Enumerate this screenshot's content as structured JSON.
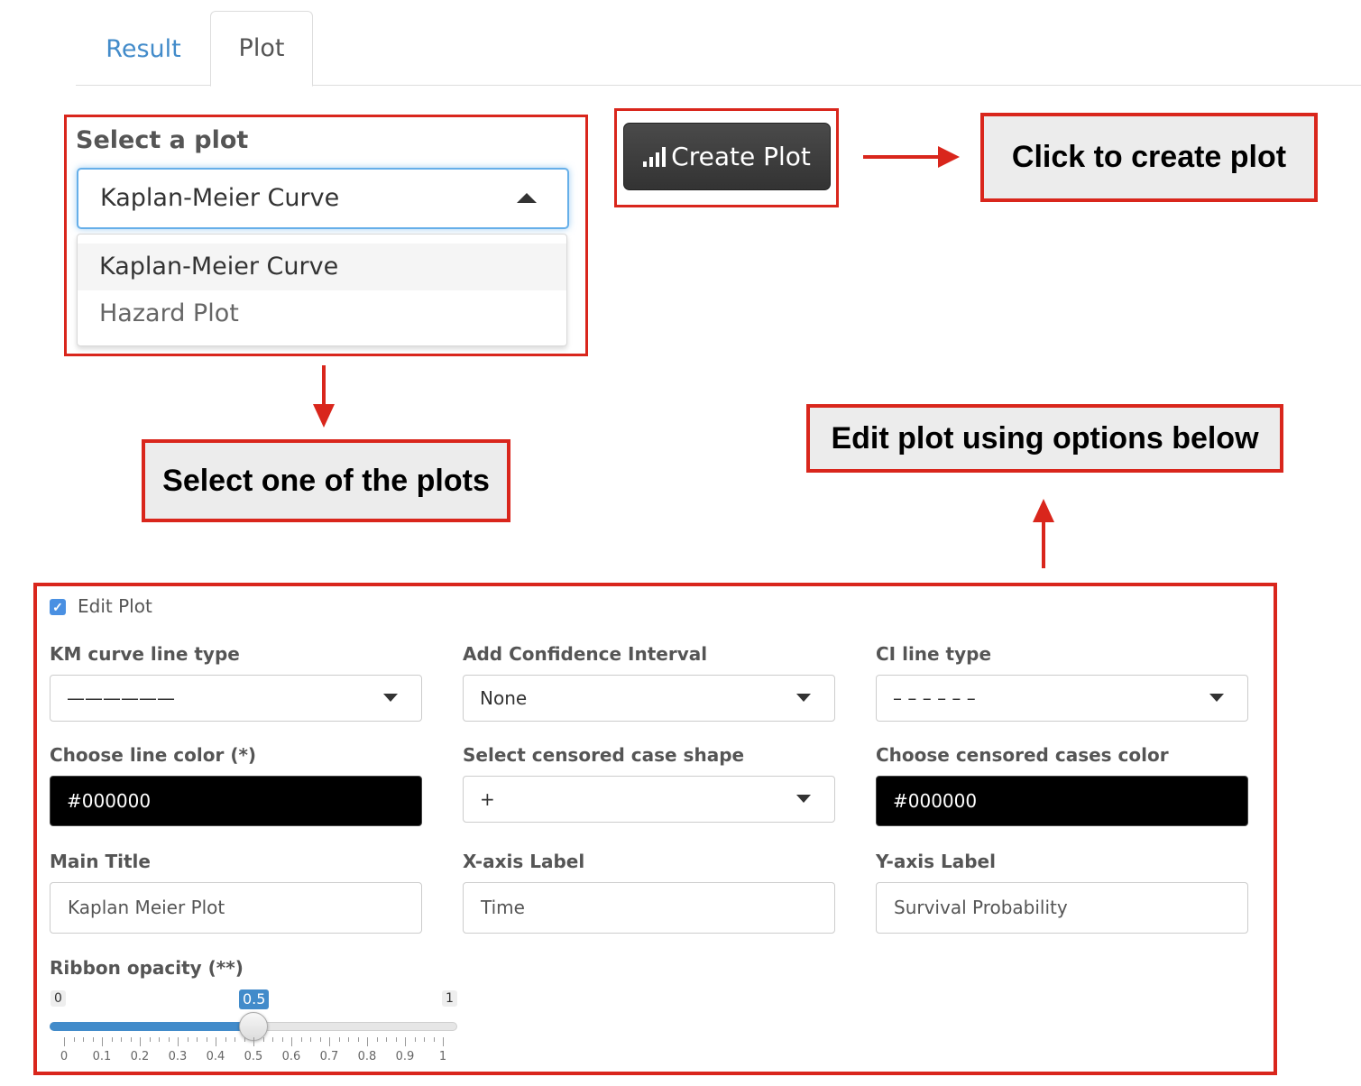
{
  "tabs": [
    {
      "label": "Result",
      "active": false
    },
    {
      "label": "Plot",
      "active": true
    }
  ],
  "plot_select": {
    "label": "Select a plot",
    "selected": "Kaplan-Meier Curve",
    "options": [
      "Kaplan-Meier Curve",
      "Hazard Plot"
    ]
  },
  "create_button": {
    "label": "Create Plot",
    "icon": "signal-bars-icon"
  },
  "callouts": {
    "create": "Click to create plot",
    "select": "Select one of the plots",
    "edit": "Edit plot using options below"
  },
  "edit_plot": {
    "checkbox_label": "Edit Plot",
    "checked": true,
    "km_line_type": {
      "label": "KM curve line type",
      "value": "——————"
    },
    "confidence_interval": {
      "label": "Add Confidence Interval",
      "value": "None"
    },
    "ci_line_type": {
      "label": "CI line type",
      "value": "– – – – – –"
    },
    "line_color": {
      "label": "Choose line color (*)",
      "value": "#000000"
    },
    "censored_shape": {
      "label": "Select censored case shape",
      "value": "+"
    },
    "censored_color": {
      "label": "Choose censored cases color",
      "value": "#000000"
    },
    "main_title": {
      "label": "Main Title",
      "value": "Kaplan Meier Plot"
    },
    "x_label": {
      "label": "X-axis Label",
      "value": "Time"
    },
    "y_label": {
      "label": "Y-axis Label",
      "value": "Survival Probability"
    },
    "ribbon_opacity": {
      "label": "Ribbon opacity (**)",
      "min": "0",
      "max": "1",
      "value": "0.5",
      "ticks": [
        "0",
        "0.1",
        "0.2",
        "0.3",
        "0.4",
        "0.5",
        "0.6",
        "0.7",
        "0.8",
        "0.9",
        "1"
      ]
    }
  },
  "colors": {
    "accent": "#428bca",
    "annotation_red": "#d9261c",
    "callout_bg": "#ececec"
  }
}
